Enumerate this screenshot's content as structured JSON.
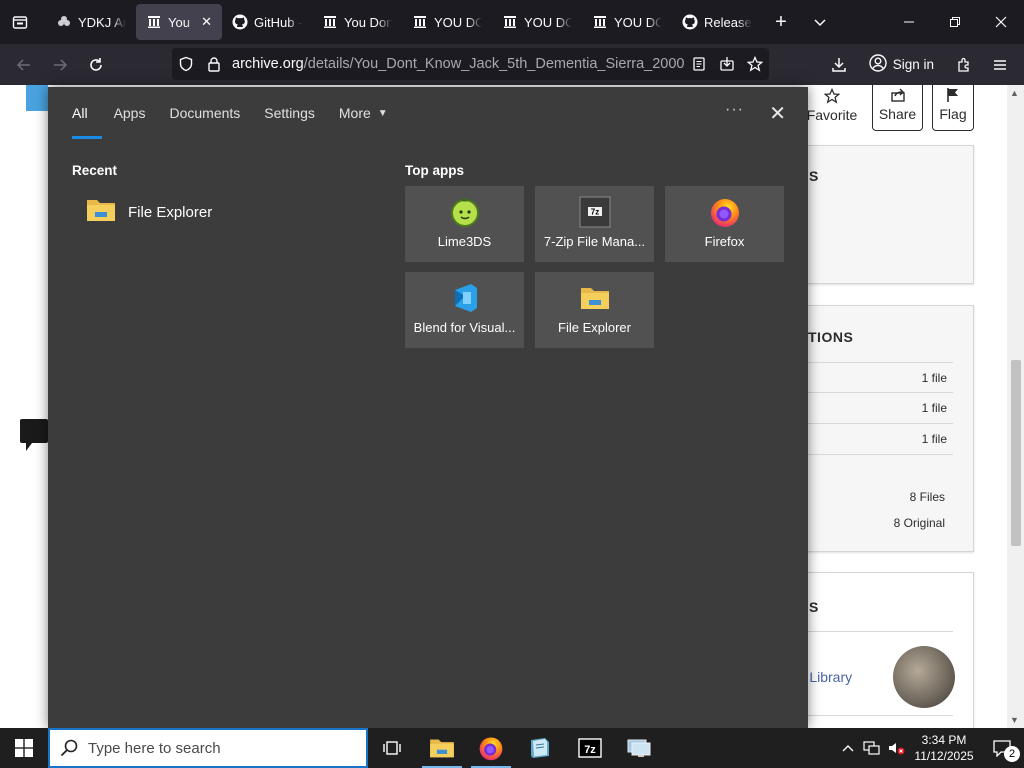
{
  "browser": {
    "tabs": [
      {
        "title": "YDKJ Arc",
        "icon": "flower-icon",
        "active": false
      },
      {
        "title": "You Do",
        "icon": "archive-icon",
        "active": true
      },
      {
        "title": "GitHub -",
        "icon": "github-icon",
        "active": false
      },
      {
        "title": "You Don'",
        "icon": "archive-icon",
        "active": false
      },
      {
        "title": "YOU DO",
        "icon": "archive-icon",
        "active": false
      },
      {
        "title": "YOU DO",
        "icon": "archive-icon",
        "active": false
      },
      {
        "title": "YOU DO",
        "icon": "archive-icon",
        "active": false
      },
      {
        "title": "Release",
        "icon": "github-icon",
        "active": false
      }
    ],
    "url_host": "archive.org",
    "url_path": "/details/You_Dont_Know_Jack_5th_Dementia_Sierra_2000",
    "sign_in_label": "Sign in"
  },
  "page": {
    "actions": {
      "favorite": "Favorite",
      "share": "Share",
      "flag": "Flag"
    },
    "panel1_heading_fragment": "S",
    "panel2_heading_fragment": "TIONS",
    "file_rows": [
      "1 file",
      "1 file",
      "1 file"
    ],
    "totals": [
      "8 Files",
      "8 Original"
    ],
    "panel3_heading_fragment": "S",
    "collection_link_fragment": "re Library"
  },
  "search_flyout": {
    "tabs": [
      "All",
      "Apps",
      "Documents",
      "Settings",
      "More"
    ],
    "active_tab": "All",
    "recent_heading": "Recent",
    "recent_items": [
      "File Explorer"
    ],
    "top_apps_heading": "Top apps",
    "top_apps": [
      {
        "label": "Lime3DS",
        "icon": "lime-icon"
      },
      {
        "label": "7-Zip File Mana...",
        "icon": "7zip-icon"
      },
      {
        "label": "Firefox",
        "icon": "firefox-icon"
      },
      {
        "label": "Blend for Visual...",
        "icon": "blend-icon"
      },
      {
        "label": "File Explorer",
        "icon": "folder-icon"
      }
    ]
  },
  "taskbar": {
    "search_placeholder": "Type here to search",
    "time": "3:34 PM",
    "date": "11/12/2025",
    "notification_count": "2"
  },
  "colors": {
    "accent": "#1a8ae5",
    "flyout_bg": "#3c3c3c",
    "tile_bg": "#515151",
    "taskbar_bg": "#1f1f1f"
  }
}
